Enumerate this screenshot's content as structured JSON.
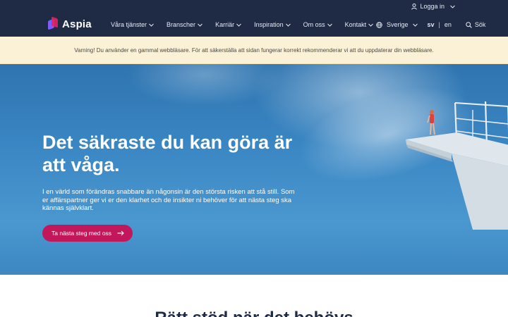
{
  "header": {
    "login": "Logga in",
    "brand": "Aspia",
    "nav": [
      {
        "label": "Våra tjänster"
      },
      {
        "label": "Branscher"
      },
      {
        "label": "Karriär"
      },
      {
        "label": "Inspiration"
      },
      {
        "label": "Om oss"
      },
      {
        "label": "Kontakt"
      }
    ],
    "region": "Sverige",
    "lang_active": "sv",
    "lang_separator": "|",
    "lang_other": "en",
    "search": "Sök"
  },
  "warning": {
    "text": "Varning! Du använder en gammal webbläsare. För att säkerställa att sidan fungerar korrekt rekommenderar vi att du uppdaterar din webbläsare."
  },
  "hero": {
    "title": "Det säkraste du kan göra är att våga.",
    "lead": "I en värld som förändras snabbare än någonsin är den största risken att stå still. Som er affärspartner ger vi er den klarhet och de insikter ni behöver för att nästa steg ska kännas självklart.",
    "cta": "Ta nästa steg med oss"
  },
  "next_section": {
    "title": "Rätt stöd när det behövs"
  },
  "colors": {
    "header_bg": "#1f2b45",
    "warning_bg": "#fbf1d6",
    "hero_sky": "#3a87c4",
    "cta": "#c2185b"
  },
  "icons": [
    "user-icon",
    "chevron-down-icon",
    "globe-icon",
    "search-icon",
    "arrow-right-icon"
  ]
}
